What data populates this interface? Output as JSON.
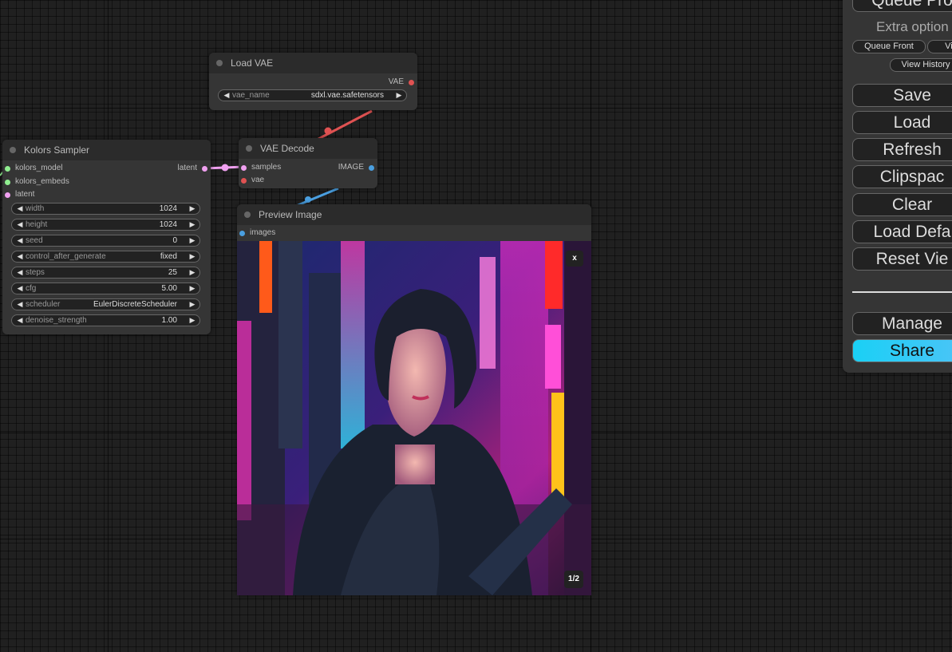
{
  "nodes": {
    "load_vae": {
      "title": "Load VAE",
      "output": "VAE",
      "widget": {
        "name": "vae_name",
        "value": "sdxl.vae.safetensors"
      }
    },
    "vae_decode": {
      "title": "VAE Decode",
      "inputs": [
        "samples",
        "vae"
      ],
      "output": "IMAGE"
    },
    "kolors_sampler": {
      "title": "Kolors Sampler",
      "inputs": [
        "kolors_model",
        "kolors_embeds",
        "latent"
      ],
      "output": "latent",
      "widgets": [
        {
          "name": "width",
          "value": "1024"
        },
        {
          "name": "height",
          "value": "1024"
        },
        {
          "name": "seed",
          "value": "0"
        },
        {
          "name": "control_after_generate",
          "value": "fixed"
        },
        {
          "name": "steps",
          "value": "25"
        },
        {
          "name": "cfg",
          "value": "5.00"
        },
        {
          "name": "scheduler",
          "value": "EulerDiscreteScheduler"
        },
        {
          "name": "denoise_strength",
          "value": "1.00"
        }
      ]
    },
    "preview_image": {
      "title": "Preview Image",
      "input": "images",
      "close_label": "x",
      "page_counter": "1/2"
    }
  },
  "menu": {
    "queue_prompt": "Queue Pro",
    "extra_options": "Extra option",
    "queue_front": "Queue Front",
    "view_queue": "Vie",
    "view_history": "View History",
    "buttons": {
      "save": "Save",
      "load": "Load",
      "refresh": "Refresh",
      "clipspace": "Clipspac",
      "clear": "Clear",
      "load_default": "Load Defa",
      "reset_view": "Reset Vie",
      "manager": "Manage",
      "share": "Share"
    }
  },
  "colors": {
    "canvas_bg": "#202020",
    "node_bg": "#353535",
    "node_title_bg": "#2b2b2b",
    "vae_link": "#e05252",
    "image_link": "#4a9fe0",
    "latent_link": "#f0a0f0",
    "model_slot": "#90ee90",
    "share_gradient_start": "#1ad0f5",
    "share_gradient_end": "#4fc3f7"
  }
}
